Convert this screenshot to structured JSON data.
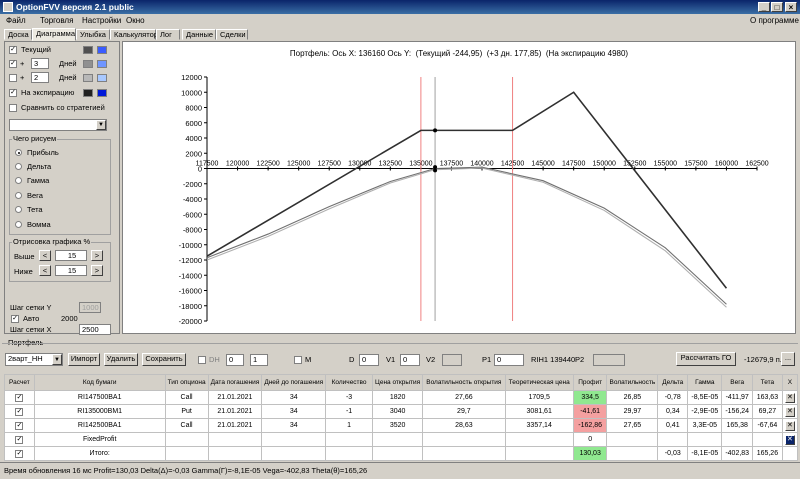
{
  "window": {
    "title": "OptionFVV версия 2.1 public",
    "about": "О программе"
  },
  "menu": [
    "Файл",
    "Торговля",
    "Настройки",
    "Окно"
  ],
  "tabs": [
    "Доска",
    "Диаграмма",
    "Улыбка",
    "Калькулятор",
    "Лог",
    "Данные",
    "Сделки"
  ],
  "active_tab": "Диаграмма",
  "sidebar": {
    "rows": [
      {
        "checked": true,
        "label": "Текущий",
        "colors": [
          "#505050",
          "#3a5cff"
        ]
      },
      {
        "checked": true,
        "prefix": "+",
        "value": "3",
        "label": "Дней",
        "colors": [
          "#909090",
          "#6f95ff"
        ]
      },
      {
        "checked": false,
        "prefix": "+",
        "value": "2",
        "label": "Дней",
        "colors": [
          "#b8b8b8",
          "#a8c8ff"
        ]
      },
      {
        "checked": true,
        "label": "На экспирацию",
        "colors": [
          "#202020",
          "#0018d8"
        ]
      }
    ],
    "compare_label": "Сравнить со стратегией",
    "what_draw": {
      "title": "Чего рисуем",
      "options": [
        "Прибыль",
        "Дельта",
        "Гамма",
        "Вега",
        "Тета",
        "Вомма"
      ],
      "selected": "Прибыль"
    },
    "range": {
      "title": "Отрисовка графика %",
      "above_label": "Выше",
      "above": "15",
      "below_label": "Ниже",
      "below": "15"
    },
    "grid_y_label": "Шаг сетки Y",
    "grid_y": "1000",
    "auto_label": "Авто",
    "auto_value": "2000",
    "grid_x_label": "Шаг сетки X",
    "grid_x": "2500"
  },
  "chart_header": {
    "portfolio": "Портфель:",
    "axis_x": "Ось X: 136160",
    "axis_y": "Ось Y:",
    "current": "(Текущий -244,95)",
    "plus3": "(+3 дн. 177,85)",
    "expiry": "(На экспирацию 4980)"
  },
  "chart_data": {
    "type": "line",
    "xlim": [
      117500,
      162500
    ],
    "ylim": [
      -20000,
      12000
    ],
    "xticks": [
      117500,
      120000,
      122500,
      125000,
      127500,
      130000,
      132500,
      135000,
      137500,
      140000,
      142500,
      145000,
      147500,
      150000,
      152500,
      155000,
      157500,
      160000,
      162500
    ],
    "yticks": [
      12000,
      10000,
      8000,
      6000,
      4000,
      2000,
      0,
      -2000,
      -4000,
      -6000,
      -8000,
      -10000,
      -12000,
      -14000,
      -16000,
      -18000,
      -20000
    ],
    "vertical_lines": [
      {
        "x": 135000,
        "color": "#f08080"
      },
      {
        "x": 136160,
        "color": "#a0a0a0"
      },
      {
        "x": 142500,
        "color": "#f08080"
      }
    ],
    "series": [
      {
        "color": "#303030",
        "x": [
          117500,
          135000,
          142500,
          147500,
          160000
        ],
        "y": [
          -11500,
          5000,
          5000,
          10000,
          -15700
        ]
      },
      {
        "color": "#707070",
        "x": [
          117500,
          122500,
          127500,
          132500,
          136160,
          140000,
          145000,
          150000,
          155000,
          160000
        ],
        "y": [
          -11700,
          -8600,
          -5000,
          -1700,
          0,
          180,
          -1600,
          -5200,
          -10400,
          -17800
        ]
      },
      {
        "color": "#b0b0b0",
        "x": [
          117500,
          122500,
          127500,
          132500,
          136160,
          140000,
          145000,
          150000,
          155000,
          160000
        ],
        "y": [
          -12000,
          -8900,
          -5300,
          -1900,
          -150,
          50,
          -1800,
          -5500,
          -10800,
          -18200
        ]
      }
    ],
    "markers": [
      {
        "x": 136160,
        "y": 5000
      },
      {
        "x": 136160,
        "y": 177.85
      },
      {
        "x": 136160,
        "y": -244.95
      }
    ]
  },
  "portfolio": {
    "section_label": "Портфель",
    "name": "2варт_НН",
    "import": "Импорт",
    "delete": "Удалить",
    "save": "Сохранить",
    "dh_label": "DH",
    "dh1": "0",
    "dh2": "1",
    "m_label": "М",
    "d_label": "D",
    "d_val": "0",
    "v1_label": "V1",
    "v1_val": "0",
    "v2_label": "V2",
    "v2_val": "",
    "p1_label": "P1",
    "p1_val": "0",
    "ri_label": "RIH1 139440",
    "p2_label": "P2",
    "p2_val": "",
    "calc_go": "Рассчитать ГО",
    "go_value": "-12679,9 п.",
    "more": "..."
  },
  "table": {
    "headers": [
      "Расчет",
      "Код бумаги",
      "Тип опциона",
      "Дата погашения",
      "Дней до погашения",
      "Количество",
      "Цена открытия",
      "Волатильность открытия",
      "Теоретическая цена",
      "Профит",
      "Волатильность",
      "Дельта",
      "Гамма",
      "Вега",
      "Тета",
      "X"
    ],
    "rows": [
      [
        "RI147500BA1",
        "Call",
        "21.01.2021",
        "34",
        "-3",
        "1820",
        "27,66",
        "1709,5",
        "334,5",
        "26,85",
        "-0,78",
        "-8,5E-05",
        "-411,97",
        "163,63"
      ],
      [
        "RI135000BM1",
        "Put",
        "21.01.2021",
        "34",
        "-1",
        "3040",
        "29,7",
        "3081,61",
        "-41,61",
        "29,97",
        "0,34",
        "-2,9E-05",
        "-156,24",
        "69,27"
      ],
      [
        "RI142500BA1",
        "Call",
        "21.01.2021",
        "34",
        "1",
        "3520",
        "28,63",
        "3357,14",
        "-162,86",
        "27,65",
        "0,41",
        "3,3E-05",
        "165,38",
        "-67,64"
      ]
    ],
    "fixed_profit_label": "FixedProfit",
    "fixed_profit_value": "0",
    "total_label": "Итого:",
    "total": {
      "profit": "130,03",
      "delta": "-0,03",
      "gamma": "-8,1E-05",
      "vega": "-402,83",
      "theta": "165,26"
    },
    "colors": {
      "profit_pos": "#90e890",
      "profit_neg": "#f4a0a0"
    }
  },
  "status": "Время обновления 16 мс  Profit=130,03 Delta(Δ)=-0,03 Gamma(Γ)=-8,1E-05 Vega=-402,83 Theta(θ)=165,26"
}
